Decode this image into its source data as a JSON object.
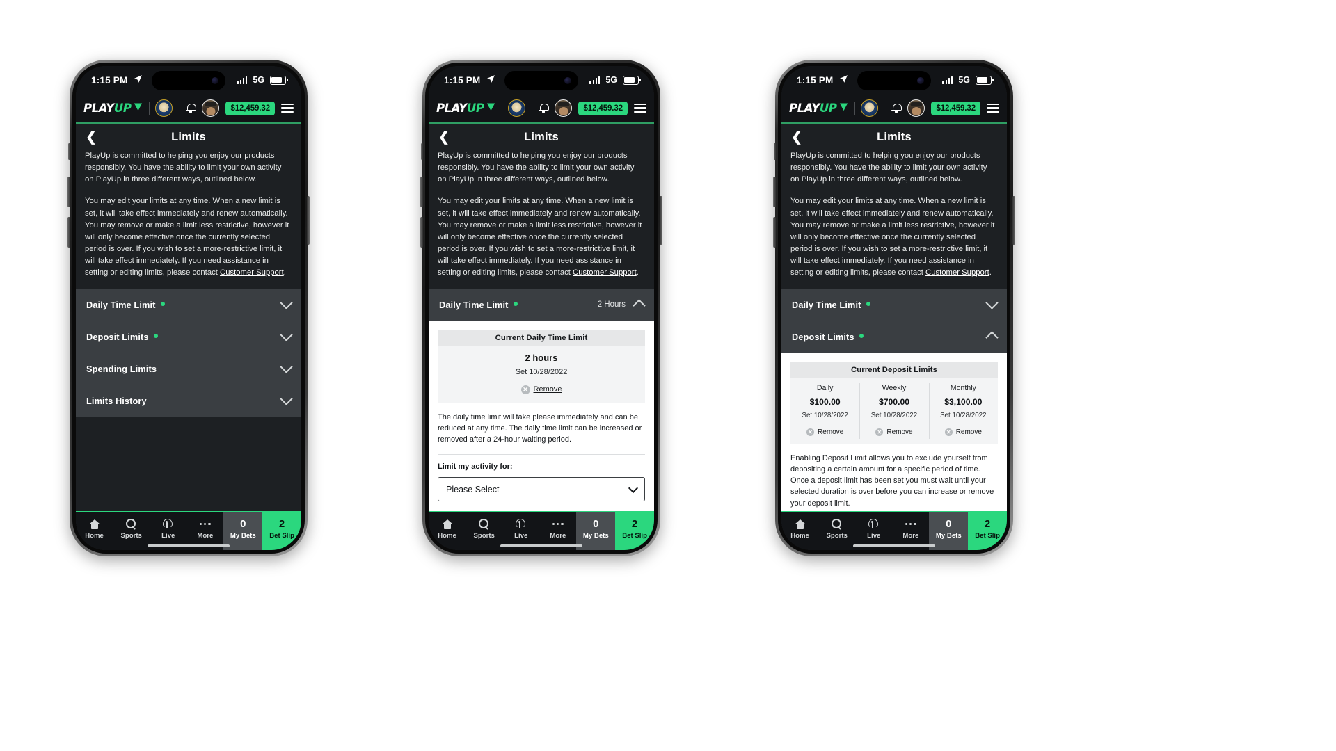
{
  "status_bar": {
    "time": "1:15 PM",
    "location_icon": "location-arrow-icon",
    "network": "5G",
    "signal_icon": "cellular-bars-icon",
    "battery_icon": "battery-icon"
  },
  "app_header": {
    "logo_play": "PLAY",
    "logo_up": "UP",
    "seal_icon": "state-seal-icon",
    "bell_icon": "notification-bell-icon",
    "avatar_icon": "user-avatar",
    "balance": "$12,459.32",
    "menu_icon": "hamburger-menu-icon",
    "accent_color": "#2bd77e"
  },
  "page": {
    "back_icon": "chevron-left-icon",
    "title": "Limits",
    "intro_p1": "PlayUp is committed to helping you enjoy our products responsibly.  You have the ability to limit your own activity on PlayUp in three different ways, outlined below.",
    "intro_p2_a": "You may edit your limits at any time. When a new limit is set, it will take effect immediately and renew automatically. You may remove or make a limit less restrictive, however it will only become effective once the currently selected period is over. If you wish to set a more-restrictive limit, it will take effect immediately. If you need assistance in setting or editing limits, please contact ",
    "intro_p2_link": "Customer Support",
    "intro_p2_b": "."
  },
  "accordion": {
    "daily_time_limit": "Daily Time Limit",
    "deposit_limits": "Deposit Limits",
    "spending_limits": "Spending Limits",
    "limits_history": "Limits History",
    "daily_time_value": "2 Hours"
  },
  "daily_time_panel": {
    "table_header": "Current Daily Time Limit",
    "value": "2 hours",
    "set_date": "Set 10/28/2022",
    "remove_label": "Remove",
    "remove_icon": "remove-x-circle-icon",
    "help_text": "The daily time limit will take please immediately and can be reduced at any time. The daily time limit can be increased or removed after a 24-hour waiting period.",
    "field_label": "Limit my activity for:",
    "select_value": "Please Select",
    "select_icon": "chevron-down-icon"
  },
  "deposit_panel": {
    "table_header": "Current Deposit  Limits",
    "columns": [
      {
        "name": "Daily",
        "amount": "$100.00",
        "set_date": "Set 10/28/2022",
        "remove_label": "Remove"
      },
      {
        "name": "Weekly",
        "amount": "$700.00",
        "set_date": "Set 10/28/2022",
        "remove_label": "Remove"
      },
      {
        "name": "Monthly",
        "amount": "$3,100.00",
        "set_date": "Set 10/28/2022",
        "remove_label": "Remove"
      }
    ],
    "help_text": "Enabling Deposit Limit allows you to exclude yourself from depositing a certain amount for a specific period of time. Once a deposit limit has been set you must wait until your selected duration is over before you can increase or remove your deposit limit."
  },
  "tabbar": {
    "home": "Home",
    "sports": "Sports",
    "live": "Live",
    "more": "More",
    "my_bets": "My Bets",
    "my_bets_count": "0",
    "bet_slip": "Bet Slip",
    "bet_slip_count": "2"
  }
}
